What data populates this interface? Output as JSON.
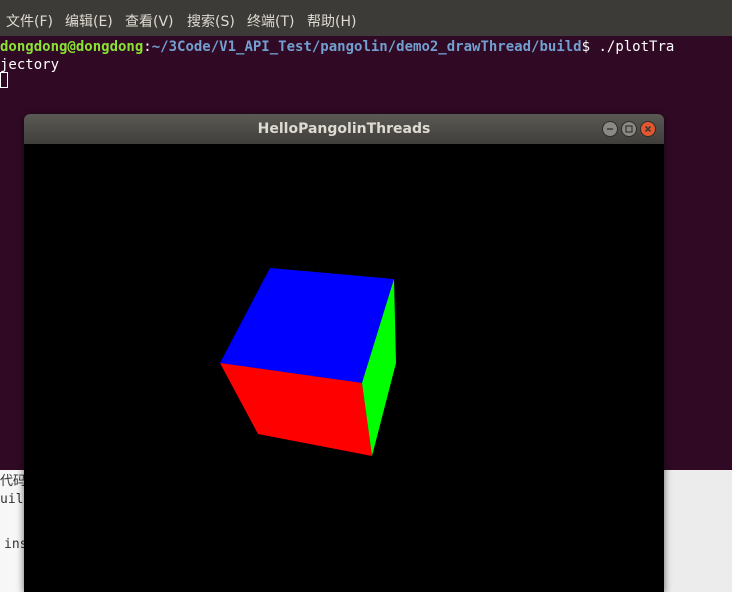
{
  "menu": {
    "items": [
      "文件(F)",
      "编辑(E)",
      "查看(V)",
      "搜索(S)",
      "终端(T)",
      "帮助(H)"
    ]
  },
  "terminal": {
    "user": "dongdong@dongdong",
    "separator": ":",
    "path": "~/3Code/V1_API_Test/pangolin/demo2_drawThread/build",
    "command": "$ ./plotTra",
    "command_wrap": "jectory"
  },
  "background_text": {
    "line1": "代码",
    "line2": "uild",
    "line3": "ins"
  },
  "window": {
    "title": "HelloPangolinThreads"
  },
  "cube": {
    "top_color": "#0000ff",
    "front_color": "#ff0000",
    "right_color": "#00ff00"
  }
}
